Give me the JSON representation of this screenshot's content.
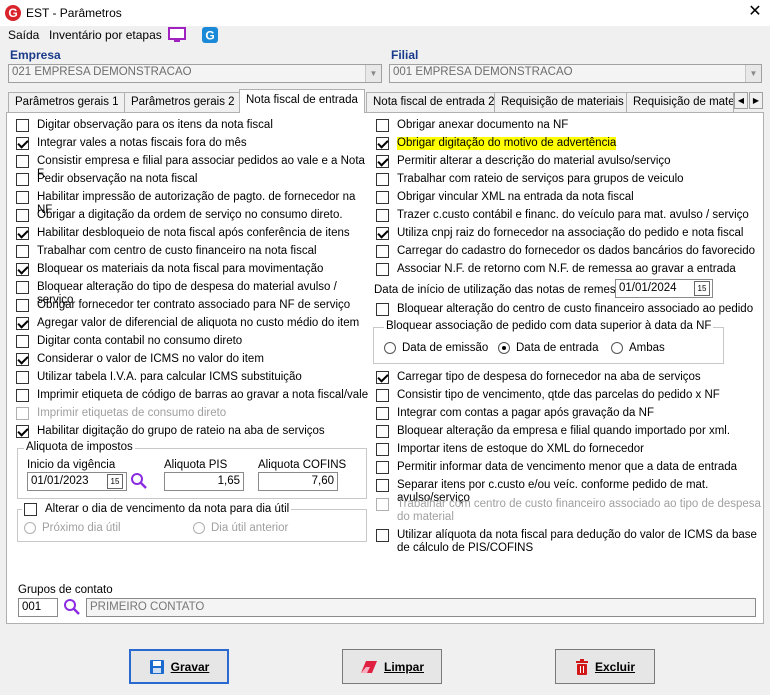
{
  "window": {
    "title": "EST - Parâmetros",
    "close_glyph": "✕"
  },
  "menu": {
    "items": [
      "Saída",
      "Inventário por etapas"
    ]
  },
  "empresa": {
    "label": "Empresa",
    "value": "021 EMPRESA DEMONSTRACAO"
  },
  "filial": {
    "label": "Filial",
    "value": "001 EMPRESA DEMONSTRACAO"
  },
  "tabs": [
    "Parâmetros gerais 1",
    "Parâmetros gerais 2",
    "Nota fiscal de entrada",
    "Nota fiscal de entrada 2",
    "Requisição de materiais",
    "Requisição de materi"
  ],
  "active_tab": 2,
  "left_checks": [
    {
      "label": "Digitar observação para os itens da nota fiscal",
      "checked": false
    },
    {
      "label": "Integrar vales a notas fiscais fora do mês",
      "checked": true
    },
    {
      "label": "Consistir empresa e filial para associar pedidos ao vale e a Nota F.",
      "checked": false
    },
    {
      "label": "Pedir observação na nota fiscal",
      "checked": false
    },
    {
      "label": "Habilitar impressão de autorização de pagto. de fornecedor na NF",
      "checked": false
    },
    {
      "label": "Obrigar a digitação da ordem de serviço no consumo direto.",
      "checked": false
    },
    {
      "label": "Habilitar desbloqueio de nota fiscal após conferência de itens",
      "checked": true
    },
    {
      "label": "Trabalhar com centro de custo financeiro na nota fiscal",
      "checked": false
    },
    {
      "label": "Bloquear os materiais da nota fiscal para movimentação",
      "checked": true
    },
    {
      "label": "Bloquear alteração do tipo de despesa do material avulso / serviço",
      "checked": false
    },
    {
      "label": "Obrigar fornecedor ter contrato associado para NF de serviço",
      "checked": false
    },
    {
      "label": "Agregar valor de diferencial de aliquota no custo médio do item",
      "checked": true
    },
    {
      "label": "Digitar conta contabil no consumo direto",
      "checked": false
    },
    {
      "label": "Considerar o valor de ICMS no valor do item",
      "checked": true
    },
    {
      "label": "Utilizar tabela I.V.A. para calcular ICMS substituição",
      "checked": false
    },
    {
      "label": "Imprimir etiqueta de código de barras ao gravar a nota fiscal/vale",
      "checked": false
    },
    {
      "label": "Imprimir etiquetas de consumo direto",
      "checked": false,
      "disabled": true
    },
    {
      "label": "Habilitar digitação do grupo de rateio na aba de serviços",
      "checked": true
    }
  ],
  "aliquota": {
    "group_title": "Aliquota de impostos",
    "inicio_label": "Inicio da vigência",
    "inicio_value": "01/01/2023",
    "pis_label": "Aliquota PIS",
    "pis_value": "1,65",
    "cofins_label": "Aliquota COFINS",
    "cofins_value": "7,60",
    "calendar_glyph": "15"
  },
  "vencimento": {
    "label": "Alterar o dia de vencimento da nota para dia útil",
    "checked": false,
    "options": [
      "Próximo dia útil",
      "Dia útil anterior"
    ]
  },
  "right_checks_top": [
    {
      "label": "Obrigar anexar documento na NF",
      "checked": false
    },
    {
      "label": "Obrigar digitação do motivo de advertência",
      "checked": true,
      "highlight": true
    },
    {
      "label": "Permitir alterar a descrição do material avulso/serviço",
      "checked": true
    },
    {
      "label": "Trabalhar com rateio de serviços para grupos de veiculo",
      "checked": false
    },
    {
      "label": "Obrigar vincular XML na entrada da nota fiscal",
      "checked": false
    },
    {
      "label": "Trazer c.custo contábil e financ. do veículo para mat. avulso / serviço",
      "checked": false
    },
    {
      "label": "Utiliza cnpj raiz do fornecedor na associação do pedido e nota fiscal",
      "checked": true
    },
    {
      "label": "Carregar do cadastro do fornecedor os dados bancários do favorecido",
      "checked": false
    },
    {
      "label": "Associar N.F. de retorno com N.F. de remessa ao gravar a entrada",
      "checked": false
    }
  ],
  "remessa": {
    "label": "Data de início de utilização das notas de remessa",
    "value": "01/01/2024"
  },
  "bloquear_ccusto": {
    "label": "Bloquear alteração do centro de custo financeiro associado ao pedido",
    "checked": false
  },
  "bloq_pedido": {
    "title": "Bloquear associação de pedido com data superior à data da NF",
    "options": [
      {
        "label": "Data de emissão",
        "checked": false
      },
      {
        "label": "Data de entrada",
        "checked": true
      },
      {
        "label": "Ambas",
        "checked": false
      }
    ]
  },
  "right_checks_bottom": [
    {
      "label": "Carregar tipo de despesa do fornecedor na aba de serviços",
      "checked": true
    },
    {
      "label": "Consistir tipo de vencimento, qtde das parcelas do pedido x NF",
      "checked": false
    },
    {
      "label": "Integrar com contas a pagar após gravação da NF",
      "checked": false
    },
    {
      "label": "Bloquear alteração da empresa e filial quando importado por xml.",
      "checked": false
    },
    {
      "label": "Importar itens de estoque do XML do fornecedor",
      "checked": false
    },
    {
      "label": "Permitir informar data de vencimento menor que a data de entrada",
      "checked": false
    },
    {
      "label": "Separar itens por c.custo e/ou veíc. conforme pedido de mat. avulso/serviço",
      "checked": false
    },
    {
      "label": "Trabalhar com centro de custo financeiro associado ao tipo de despesa do material",
      "checked": false,
      "disabled": true
    },
    {
      "label": "Utilizar alíquota da nota fiscal para dedução do valor de ICMS da base de cálculo de PIS/COFINS",
      "checked": false
    }
  ],
  "grupos": {
    "label": "Grupos de contato",
    "code": "001",
    "name": "PRIMEIRO CONTATO"
  },
  "buttons": {
    "gravar": "Gravar",
    "limpar": "Limpar",
    "excluir": "Excluir"
  }
}
